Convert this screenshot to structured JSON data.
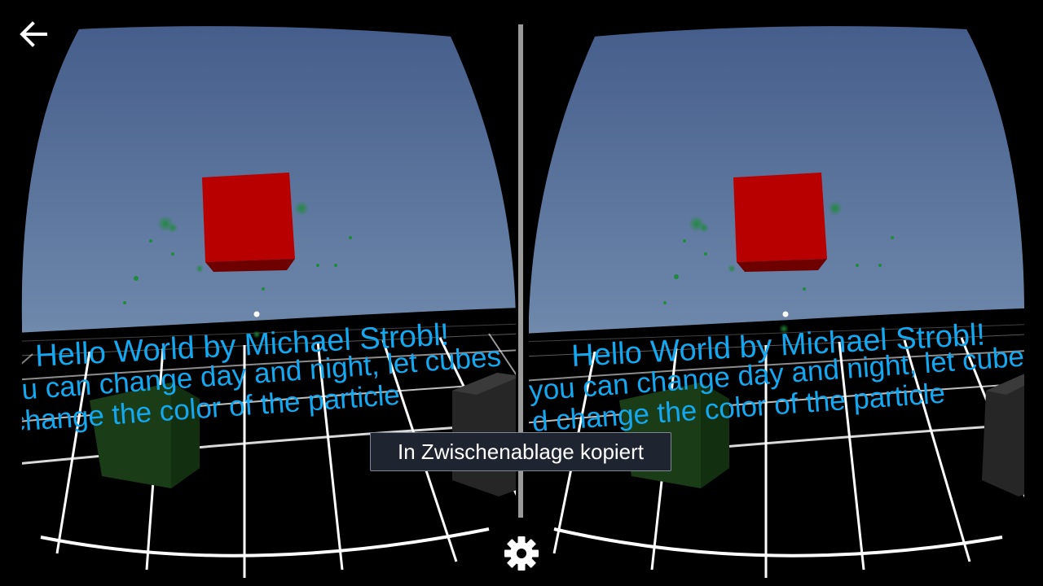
{
  "scene": {
    "title_text": "Hello World by Michael Strobl!",
    "line2_left": "ou can change day and night, let cubes",
    "line2_right": "you can change day and night, let cube",
    "line3_left": "change the color of the particle",
    "line3_right": "d change the color of the particle",
    "colors": {
      "sky_top": "#46608c",
      "sky_bottom": "#d3dfe9",
      "ground": "#000000",
      "grid": "#ffffff",
      "text": "#14a8f0",
      "red_cube": "#b80000",
      "green_cube": "#1a3d18",
      "gray_cube": "#2a2a2a",
      "particles": "#1f8a3a"
    }
  },
  "toolbar": {
    "back_icon": "arrow-left-icon",
    "settings_icon": "gear-icon"
  },
  "toast": {
    "message": "In Zwischenablage kopiert"
  }
}
